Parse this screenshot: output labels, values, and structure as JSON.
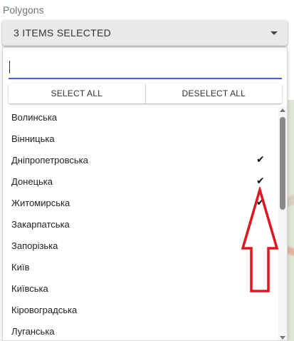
{
  "field": {
    "label": "Polygons",
    "selected_text": "3 ITEMS SELECTED",
    "caret_icon": "caret-down-icon"
  },
  "search": {
    "value": "",
    "placeholder": ""
  },
  "actions": {
    "select_all": "SELECT ALL",
    "deselect_all": "DESELECT ALL"
  },
  "options": [
    {
      "label": "Волинська",
      "checked": false
    },
    {
      "label": "Вінницька",
      "checked": false
    },
    {
      "label": "Дніпропетровська",
      "checked": true,
      "check": "✔"
    },
    {
      "label": "Донецька",
      "checked": true,
      "check": "✔"
    },
    {
      "label": "Житомирська",
      "checked": true,
      "check": "✔"
    },
    {
      "label": "Закарпатська",
      "checked": false
    },
    {
      "label": "Запорізька",
      "checked": false
    },
    {
      "label": "Київ",
      "checked": false
    },
    {
      "label": "Київська",
      "checked": false
    },
    {
      "label": "Кіровоградська",
      "checked": false
    },
    {
      "label": "Луганська",
      "checked": false
    }
  ],
  "annotation": {
    "icon": "red-arrow-up-icon",
    "color": "#e0151f"
  }
}
